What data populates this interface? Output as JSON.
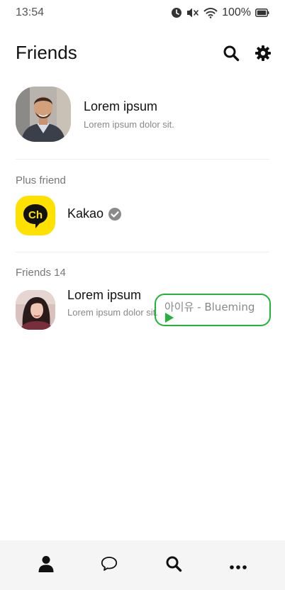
{
  "status_bar": {
    "time": "13:54",
    "battery_text": "100%",
    "icons": [
      "alarm-icon",
      "mute-icon",
      "wifi-icon",
      "battery-icon"
    ]
  },
  "header": {
    "title": "Friends",
    "actions": [
      "search-icon",
      "gear-icon"
    ]
  },
  "my_profile": {
    "name": "Lorem ipsum",
    "status": "Lorem ipsum dolor sit."
  },
  "plus_friend": {
    "section_label": "Plus friend",
    "name": "Kakao",
    "logo_text": "Ch",
    "logo_color": "#ffe100",
    "verified": true
  },
  "friends": {
    "section_label": "Friends 14",
    "items": [
      {
        "name": "Lorem ipsum",
        "status": "Lorem ipsum dolor sit.",
        "music": "아이유 - Blueming"
      }
    ]
  },
  "tab_bar": {
    "tabs": [
      "person-icon",
      "chat-bubble-icon",
      "search-icon",
      "more-icon"
    ]
  },
  "colors": {
    "music_border": "#22b43a",
    "kakao_yellow": "#ffe100",
    "tab_bar_bg": "#f5f5f5"
  }
}
